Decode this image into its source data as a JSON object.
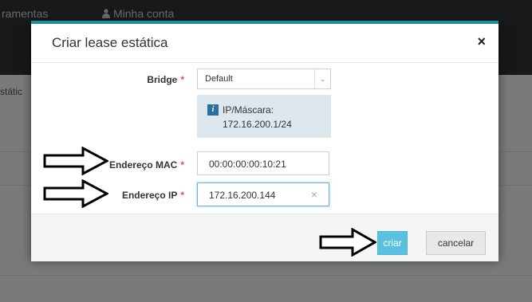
{
  "background": {
    "nav_items": [
      "ramentas",
      "Minha conta"
    ],
    "side_text": "státic"
  },
  "modal": {
    "title": "Criar lease estática",
    "close_symbol": "×",
    "bridge": {
      "label": "Bridge",
      "required_mark": "*",
      "selected": "Default",
      "arrow": "⌄"
    },
    "info": {
      "icon": "i",
      "line1": "IP/Máscara:",
      "line2": "172.16.200.1/24"
    },
    "mac": {
      "label": "Endereço MAC",
      "required_mark": "*",
      "value": "00:00:00:00:10:21"
    },
    "ip": {
      "label": "Endereço IP",
      "required_mark": "*",
      "value": "172.16.200.144",
      "clear_symbol": "×"
    },
    "buttons": {
      "create": "criar",
      "cancel": "cancelar"
    }
  },
  "colors": {
    "accent": "#1f8f9a",
    "primary_button": "#5bc0de",
    "required": "#d9534f",
    "info_bg": "#dde7ed"
  }
}
